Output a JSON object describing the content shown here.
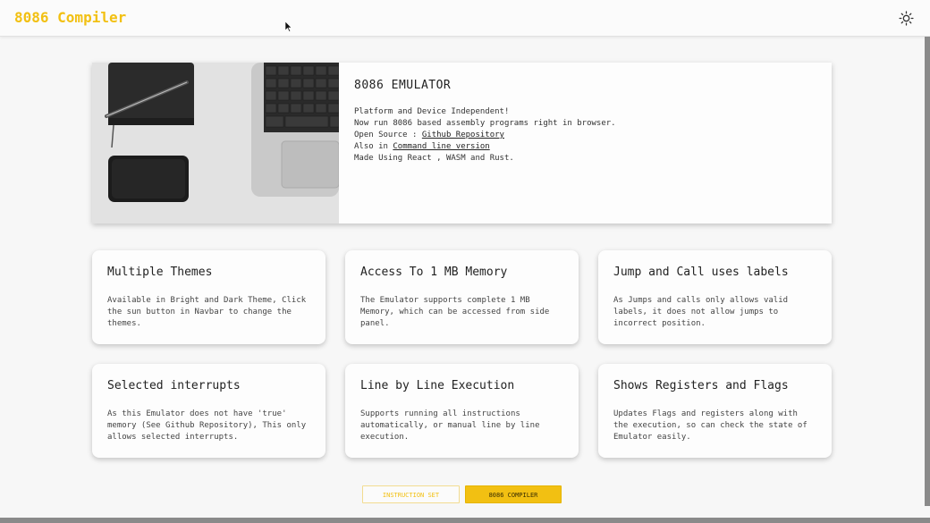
{
  "navbar": {
    "brand": "8086 Compiler",
    "theme_icon": "sun-icon"
  },
  "hero": {
    "title": "8086 EMULATOR",
    "line1": "Platform and Device Independent!",
    "line2": "Now run 8086 based assembly programs right in browser.",
    "open_source_prefix": "Open Source : ",
    "github_link": "Github Repository",
    "also_prefix": "Also in ",
    "cli_link": "Command line version",
    "made_using": "Made Using React , WASM and Rust."
  },
  "features": [
    {
      "title": "Multiple Themes",
      "desc": "Available in Bright and Dark Theme, Click the sun button in Navbar to change the themes."
    },
    {
      "title": "Access To 1 MB Memory",
      "desc": "The Emulator supports complete 1 MB Memory, which can be accessed from side panel."
    },
    {
      "title": "Jump and Call uses labels",
      "desc": "As Jumps and calls only allows valid labels, it does not allow jumps to incorrect position."
    },
    {
      "title": "Selected interrupts",
      "desc": "As this Emulator does not have 'true' memory (See Github Repository), This only allows selected interrupts."
    },
    {
      "title": "Line by Line Execution",
      "desc": "Supports running all instructions automatically, or manual line by line execution."
    },
    {
      "title": "Shows Registers and Flags",
      "desc": "Updates Flags and registers along with the execution, so can check the state of Emulator easily."
    }
  ],
  "tabs": {
    "instruction_set": "INSTRUCTION SET",
    "compiler": "8086 COMPILER"
  },
  "colors": {
    "accent": "#f2c012",
    "background": "#f7f7f7"
  }
}
